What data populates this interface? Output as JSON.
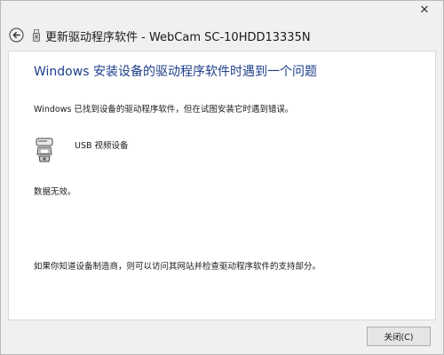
{
  "titlebar": {
    "close_glyph": "✕"
  },
  "header": {
    "title": "更新驱动程序软件 - WebCam SC-10HDD13335N"
  },
  "content": {
    "heading": "Windows 安装设备的驱动程序软件时遇到一个问题",
    "found_text": "Windows 已找到设备的驱动程序软件，但在试图安装它时遇到错误。",
    "device_name": "USB 视频设备",
    "error_text": "数据无效。",
    "help_text": "如果你知道设备制造商，则可以访问其网站并检查驱动程序软件的支持部分。"
  },
  "footer": {
    "close_label": "关闭(C)"
  },
  "icons": {
    "back": "back-arrow-icon",
    "device_small": "usb-device-icon",
    "device_large": "webcam-device-icon"
  },
  "colors": {
    "heading": "#1e3f8a",
    "window_bg": "#f0f0f0",
    "content_bg": "#ffffff"
  }
}
